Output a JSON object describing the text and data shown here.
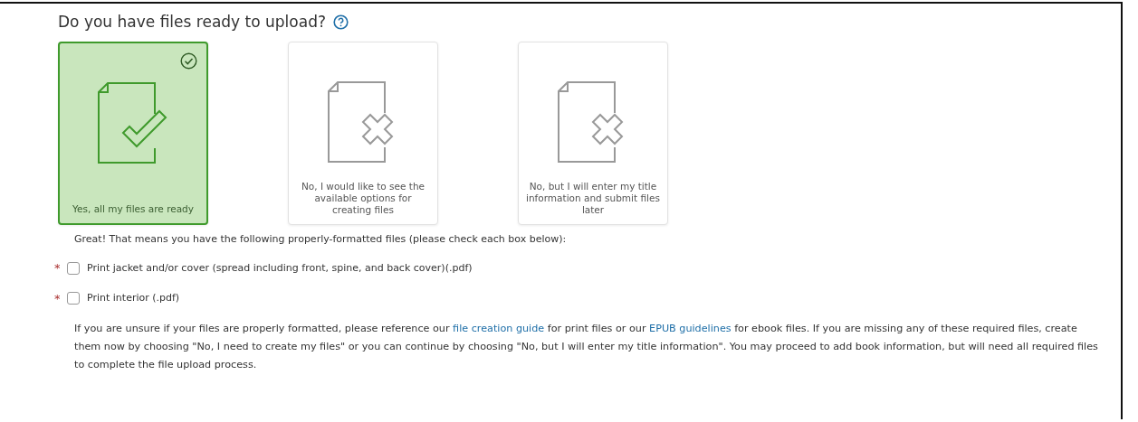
{
  "question": {
    "text": "Do you have files ready to upload?"
  },
  "options": [
    {
      "kind": "yes",
      "label": "Yes, all my files are ready",
      "selected": true
    },
    {
      "kind": "no",
      "label": "No, I would like to see the available options for creating files",
      "selected": false
    },
    {
      "kind": "no",
      "label": "No, but I will enter my title information and submit files later",
      "selected": false
    }
  ],
  "intro": "Great! That means you have the following properly-formatted files (please check each box below):",
  "checklist": [
    {
      "marker": "*",
      "label": "Print jacket and/or cover (spread including front, spine, and back cover)(.pdf)",
      "checked": false
    },
    {
      "marker": "*",
      "label": "Print interior (.pdf)",
      "checked": false
    }
  ],
  "note": [
    {
      "kind": "text",
      "text": "If you are unsure if your files are properly formatted, please reference our "
    },
    {
      "kind": "link",
      "text": "file creation guide"
    },
    {
      "kind": "text",
      "text": " for print files or our "
    },
    {
      "kind": "link",
      "text": "EPUB guidelines"
    },
    {
      "kind": "text",
      "text": " for ebook files. If you are missing any of these required files, create them now by choosing \"No, I need to create my files\" or you can continue by choosing \"No, but I will enter my title information\". You may proceed to add book information, but will need all required files to complete the file upload process."
    }
  ]
}
